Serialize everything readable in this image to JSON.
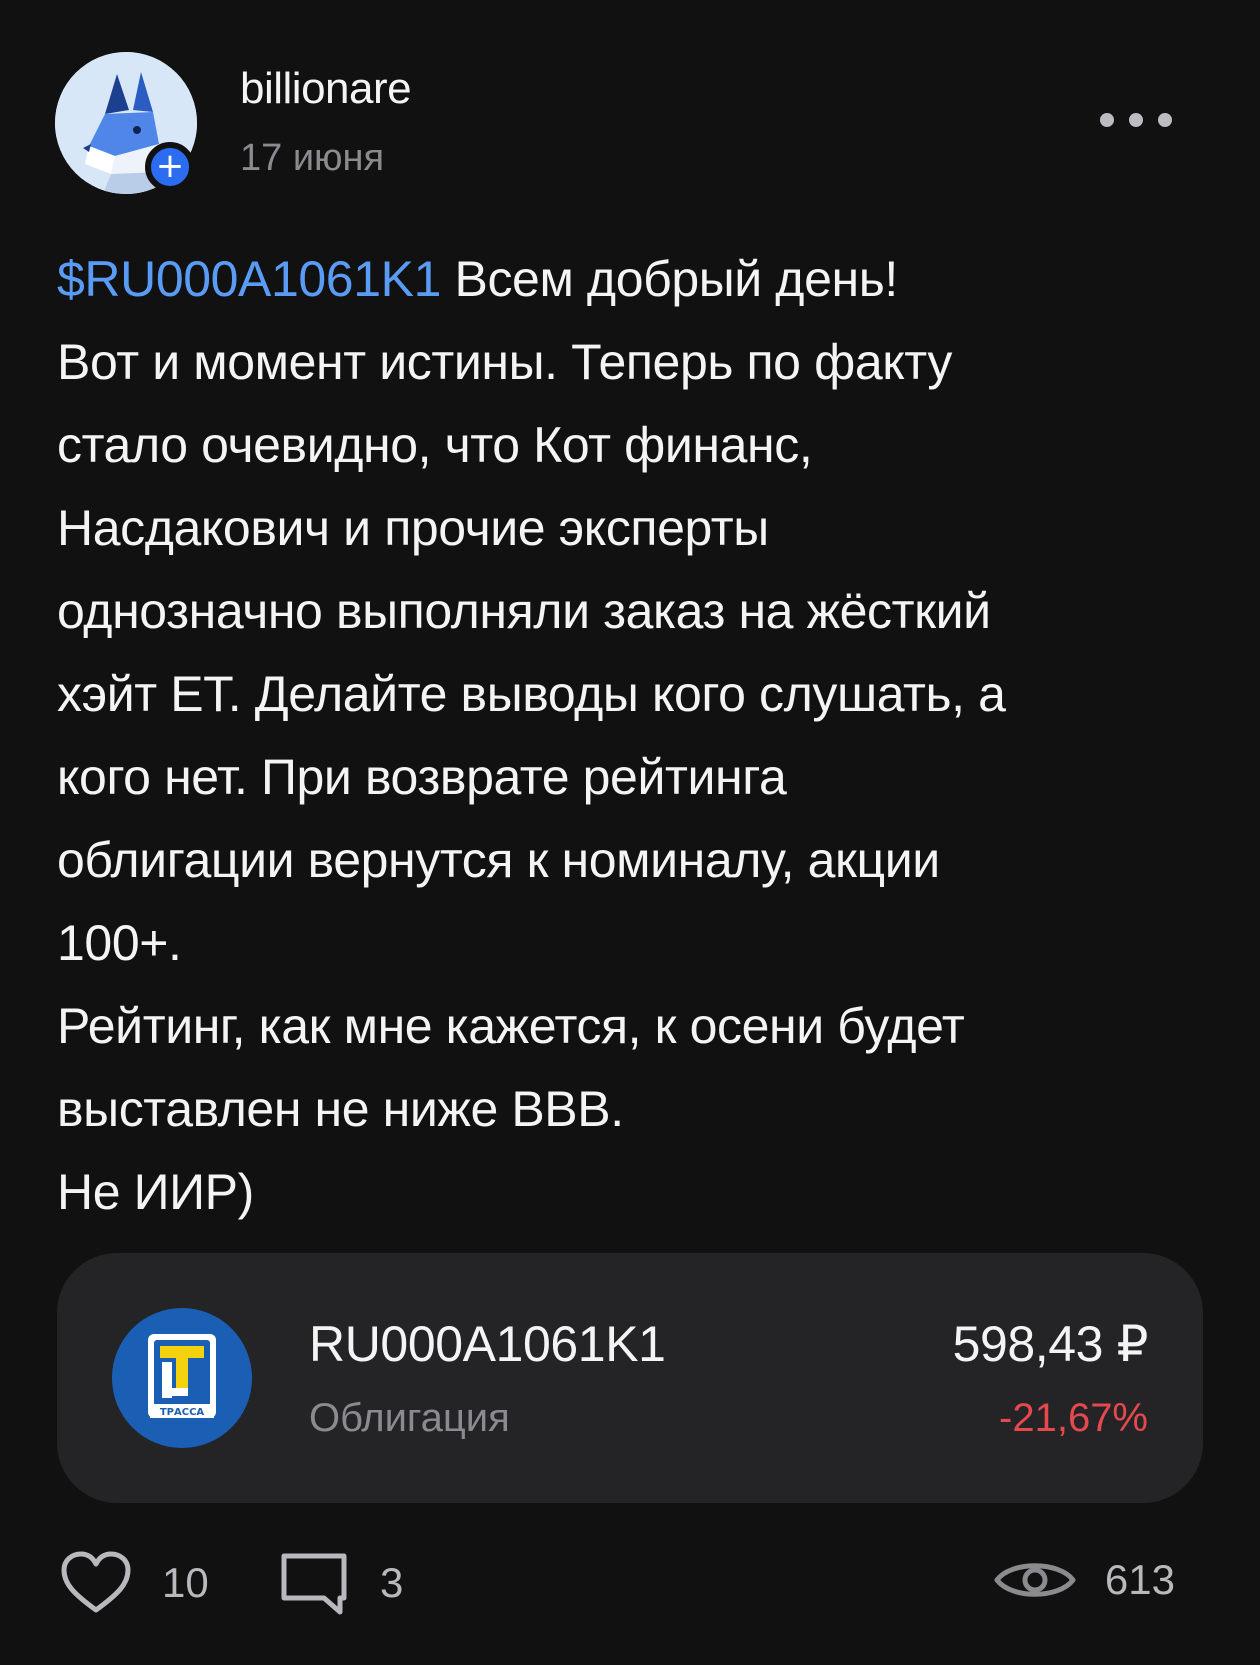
{
  "post": {
    "author": {
      "name": "billionare",
      "avatar_icon": "wolf-avatar-icon",
      "follow_icon": "+",
      "follow_icon_name": "plus-icon"
    },
    "date": "17 июня",
    "more_icon": "more-dots-icon",
    "body": {
      "ticker_tag": "$RU000A1061K1",
      "lines": [
        " Всем добрый день!",
        "Вот и момент истины. Теперь по факту",
        "стало очевидно, что Кот финанс,",
        "Насдакович и прочие эксперты",
        "однозначно выполняли заказ на жёсткий",
        "хэйт ЕТ. Делайте выводы кого слушать, а",
        "кого нет. При возврате рейтинга",
        "облигации вернутся к номиналу, акции",
        "100+.",
        "Рейтинг, как мне кажется, к осени будет",
        "выставлен не ниже ВВВ.",
        "Не ИИР)"
      ]
    },
    "instrument": {
      "logo_icon": "trassa-logo-icon",
      "logo_text": "ТРАССА",
      "ticker": "RU000A1061K1",
      "type": "Облигация",
      "price": "598,43 ₽",
      "change": "-21,67%",
      "change_color": "#e5484d"
    },
    "footer": {
      "likes": "10",
      "comments": "3",
      "views": "613",
      "like_icon": "heart-icon",
      "comment_icon": "comment-icon",
      "views_icon": "eye-icon"
    }
  },
  "colors": {
    "background": "#111112",
    "card": "#242426",
    "link": "#5a9cf5",
    "accent": "#2b6cf0",
    "secondary_text": "#8b8b8f"
  }
}
